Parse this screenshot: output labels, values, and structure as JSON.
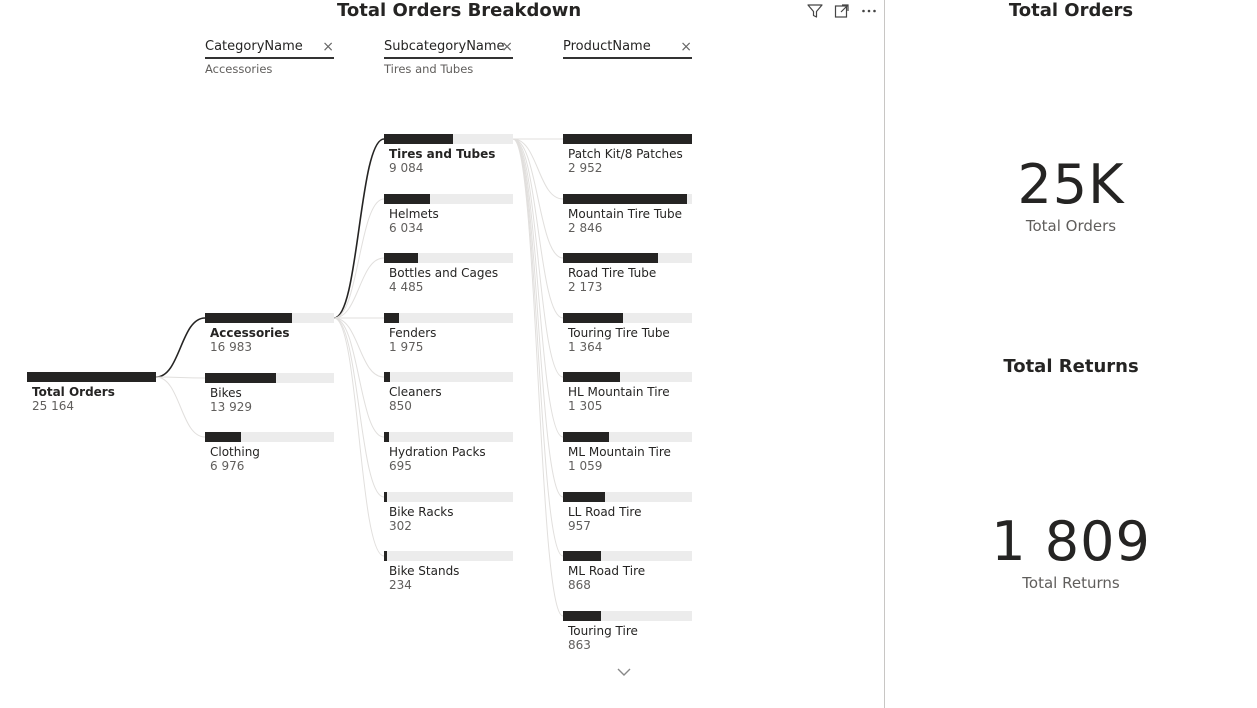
{
  "decomposition_tree": {
    "title": "Total Orders Breakdown",
    "header_icons": [
      "filter-icon",
      "focus-mode-icon",
      "more-options-icon"
    ],
    "levels": [
      {
        "name": "CategoryName",
        "filter": "Accessories"
      },
      {
        "name": "SubcategoryName",
        "filter": "Tires and Tubes"
      },
      {
        "name": "ProductName",
        "filter": ""
      }
    ],
    "close_glyph": "×",
    "root": {
      "label": "Total Orders",
      "value": "25 164",
      "amount": 25164
    },
    "categories": [
      {
        "label": "Accessories",
        "value": "16 983",
        "amount": 16983,
        "selected": true
      },
      {
        "label": "Bikes",
        "value": "13 929",
        "amount": 13929,
        "selected": false
      },
      {
        "label": "Clothing",
        "value": "6 976",
        "amount": 6976,
        "selected": false
      }
    ],
    "subcategories": [
      {
        "label": "Tires and Tubes",
        "value": "9 084",
        "amount": 9084,
        "selected": true
      },
      {
        "label": "Helmets",
        "value": "6 034",
        "amount": 6034,
        "selected": false
      },
      {
        "label": "Bottles and Cages",
        "value": "4 485",
        "amount": 4485,
        "selected": false
      },
      {
        "label": "Fenders",
        "value": "1 975",
        "amount": 1975,
        "selected": false
      },
      {
        "label": "Cleaners",
        "value": "850",
        "amount": 850,
        "selected": false
      },
      {
        "label": "Hydration Packs",
        "value": "695",
        "amount": 695,
        "selected": false
      },
      {
        "label": "Bike Racks",
        "value": "302",
        "amount": 302,
        "selected": false
      },
      {
        "label": "Bike Stands",
        "value": "234",
        "amount": 234,
        "selected": false
      }
    ],
    "products": [
      {
        "label": "Patch Kit/8 Patches",
        "value": "2 952",
        "amount": 2952
      },
      {
        "label": "Mountain Tire Tube",
        "value": "2 846",
        "amount": 2846
      },
      {
        "label": "Road Tire Tube",
        "value": "2 173",
        "amount": 2173
      },
      {
        "label": "Touring Tire Tube",
        "value": "1 364",
        "amount": 1364
      },
      {
        "label": "HL Mountain Tire",
        "value": "1 305",
        "amount": 1305
      },
      {
        "label": "ML Mountain Tire",
        "value": "1 059",
        "amount": 1059
      },
      {
        "label": "LL Road Tire",
        "value": "957",
        "amount": 957
      },
      {
        "label": "ML Road Tire",
        "value": "868",
        "amount": 868
      },
      {
        "label": "Touring Tire",
        "value": "863",
        "amount": 863
      }
    ],
    "scroll_icon": "chevron-down-icon"
  },
  "cards": {
    "orders": {
      "title": "Total Orders",
      "value": "25K",
      "label": "Total Orders"
    },
    "returns": {
      "title": "Total Returns",
      "value": "1 809",
      "label": "Total Returns"
    }
  },
  "colors": {
    "bar": "#252423",
    "track": "#ececec",
    "connector": "#252423",
    "connector_faint": "#e1dfdd"
  }
}
